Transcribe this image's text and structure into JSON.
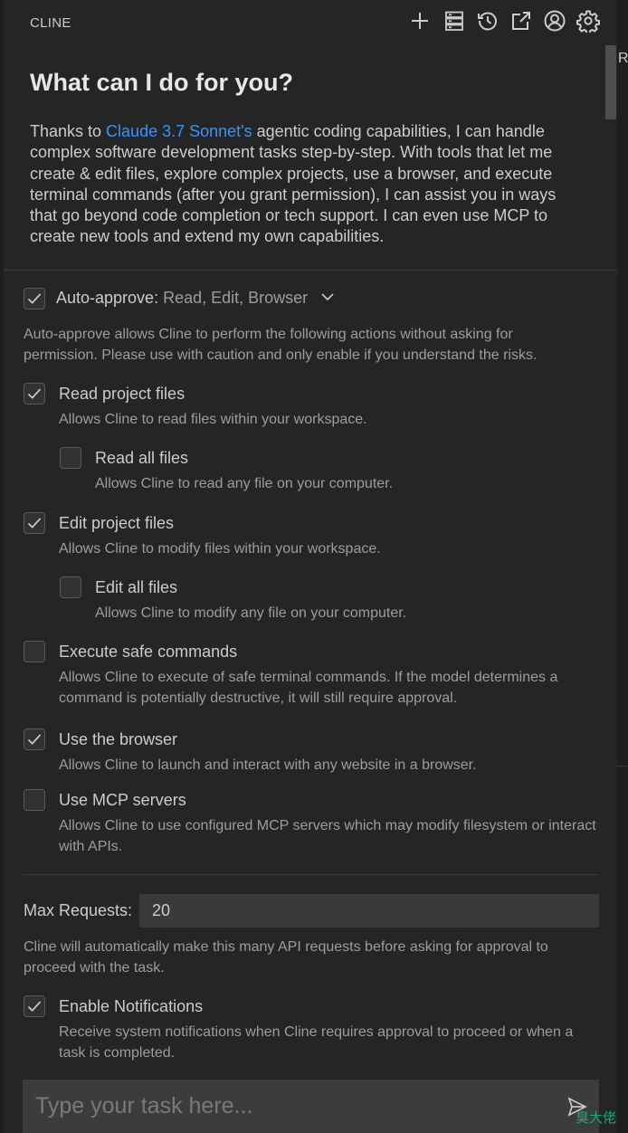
{
  "header": {
    "title": "CLINE",
    "icons": [
      "plus-icon",
      "server-icon",
      "history-icon",
      "popout-icon",
      "account-icon",
      "gear-icon"
    ]
  },
  "edge_text": "R",
  "welcome": {
    "title": "What can I do for you?",
    "text_before": "Thanks to ",
    "link": "Claude 3.7 Sonnet's",
    "text_after": " agentic coding capabilities, I can handle complex software development tasks step-by-step. With tools that let me create & edit files, explore complex projects, use a browser, and execute terminal commands (after you grant permission), I can assist you in ways that go beyond code completion or tech support. I can even use MCP to create new tools and extend my own capabilities."
  },
  "auto_approve": {
    "label": "Auto-approve:",
    "summary": "Read, Edit, Browser",
    "checked": true,
    "description": "Auto-approve allows Cline to perform the following actions without asking for permission. Please use with caution and only enable if you understand the risks.",
    "items": [
      {
        "title": "Read project files",
        "desc": "Allows Cline to read files within your workspace.",
        "checked": true
      },
      {
        "title": "Read all files",
        "desc": "Allows Cline to read any file on your computer.",
        "checked": false
      },
      {
        "title": "Edit project files",
        "desc": "Allows Cline to modify files within your workspace.",
        "checked": true
      },
      {
        "title": "Edit all files",
        "desc": "Allows Cline to modify any file on your computer.",
        "checked": false
      },
      {
        "title": "Execute safe commands",
        "desc": "Allows Cline to execute of safe terminal commands. If the model determines a command is potentially destructive, it will still require approval.",
        "checked": false
      },
      {
        "title": "Use the browser",
        "desc": "Allows Cline to launch and interact with any website in a browser.",
        "checked": true
      },
      {
        "title": "Use MCP servers",
        "desc": "Allows Cline to use configured MCP servers which may modify filesystem or interact with APIs.",
        "checked": false
      }
    ]
  },
  "max_requests": {
    "label": "Max Requests:",
    "value": "20",
    "description": "Cline will automatically make this many API requests before asking for approval to proceed with the task."
  },
  "notifications": {
    "title": "Enable Notifications",
    "desc": "Receive system notifications when Cline requires approval to proceed or when a task is completed.",
    "checked": true
  },
  "task_input": {
    "placeholder": "Type your task here..."
  },
  "watermark": "臭大佬",
  "colors": {
    "background": "#252526",
    "link": "#3794ff",
    "text": "#cccccc",
    "muted": "#9d9d9d",
    "watermark": "#19a974"
  }
}
